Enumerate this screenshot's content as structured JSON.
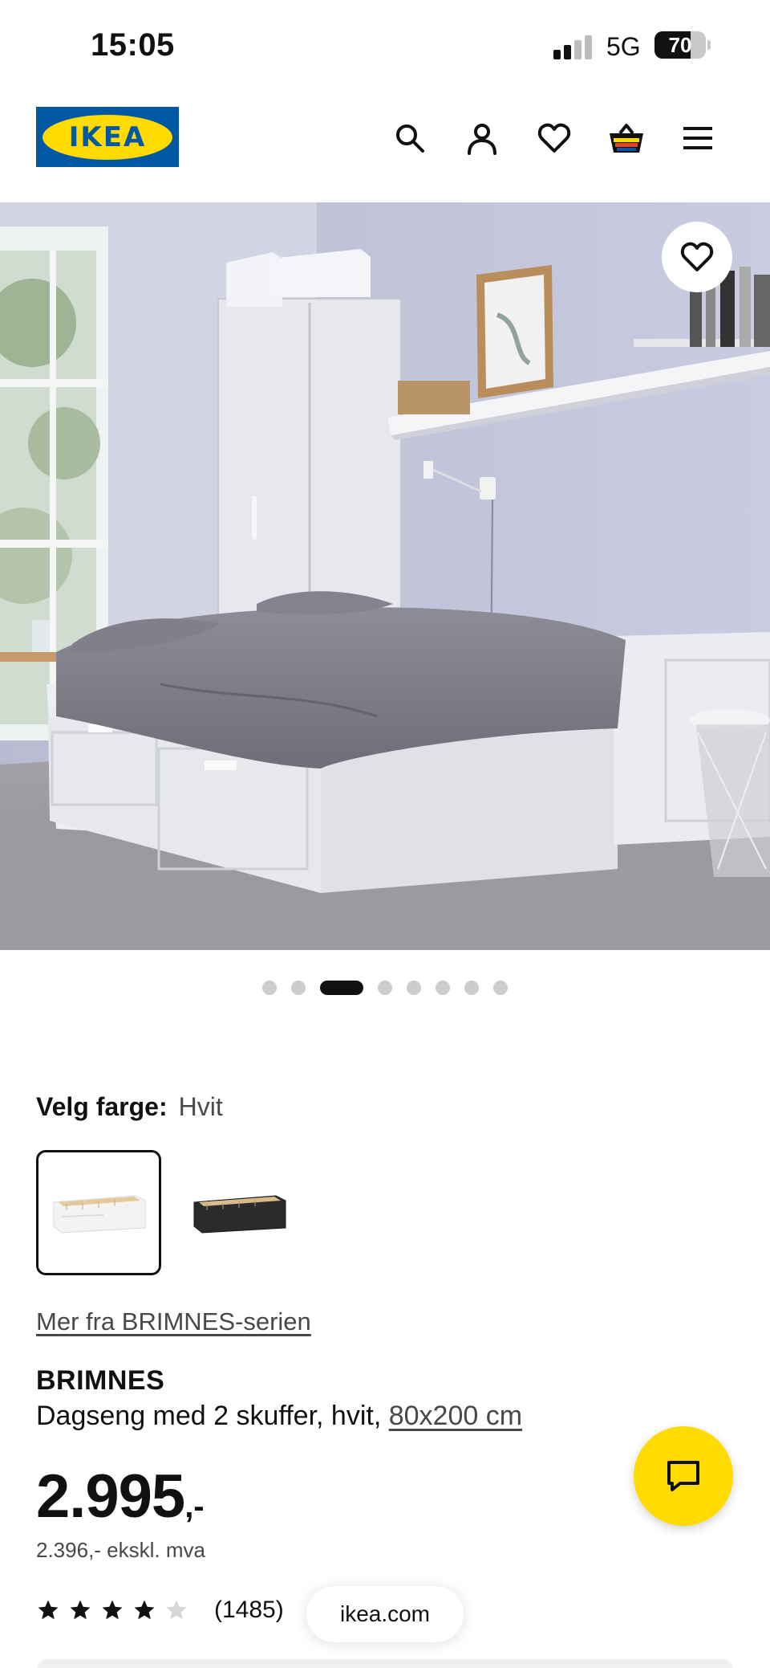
{
  "status_bar": {
    "time": "15:05",
    "network": "5G",
    "battery_percent": "70",
    "battery_level": 0.7,
    "signal_bars_active": 2
  },
  "header": {
    "logo_text": "IKEA",
    "icons": [
      "search-icon",
      "account-icon",
      "favorites-icon",
      "cart-icon",
      "menu-icon"
    ]
  },
  "gallery": {
    "image_count": 8,
    "active_index": 3,
    "favorite_icon": "heart-icon"
  },
  "color_picker": {
    "label": "Velg farge:",
    "selected_value": "Hvit",
    "options": [
      "Hvit",
      "Svart"
    ]
  },
  "product": {
    "series_link": "Mer fra BRIMNES-serien",
    "brand": "BRIMNES",
    "description": "Dagseng med 2 skuffer, hvit,",
    "size_link": "80x200 cm",
    "price_main": "2.995",
    "price_suffix": ",-",
    "price_excl_vat": "2.396,- ekskl. mva",
    "rating_value": 4,
    "rating_max": 5,
    "review_count": "(1485)"
  },
  "browser": {
    "url": "ikea.com"
  },
  "colors": {
    "ikea_blue": "#0058a3",
    "ikea_yellow": "#ffdb00",
    "text": "#111111",
    "muted": "#484848"
  }
}
